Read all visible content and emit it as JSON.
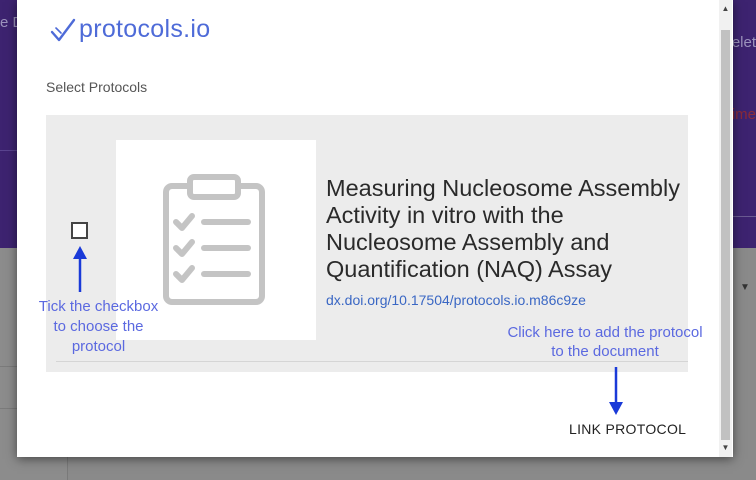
{
  "background": {
    "left_text": "e D",
    "right_text": "elet",
    "red_text": "rime"
  },
  "modal": {
    "logo_text": "protocols.io",
    "section_label": "Select Protocols",
    "protocol": {
      "title": "Measuring Nucleosome Assembly Activity in vitro with the Nucleosome Assembly and Quantification (NAQ) Assay",
      "doi": "dx.doi.org/10.17504/protocols.io.m86c9ze",
      "checked": false,
      "thumbnail_icon": "clipboard-checklist-icon"
    },
    "annotations": {
      "checkbox_hint": "Tick the checkbox to choose the protocol",
      "link_hint": "Click here to add the protocol to the document"
    },
    "link_button_label": "LINK PROTOCOL"
  },
  "colors": {
    "brand": "#4e6bd8",
    "annotation": "#5b69e0",
    "arrow": "#1a3ad8",
    "link": "#3a67c4",
    "header_bg": "#3d2370"
  }
}
